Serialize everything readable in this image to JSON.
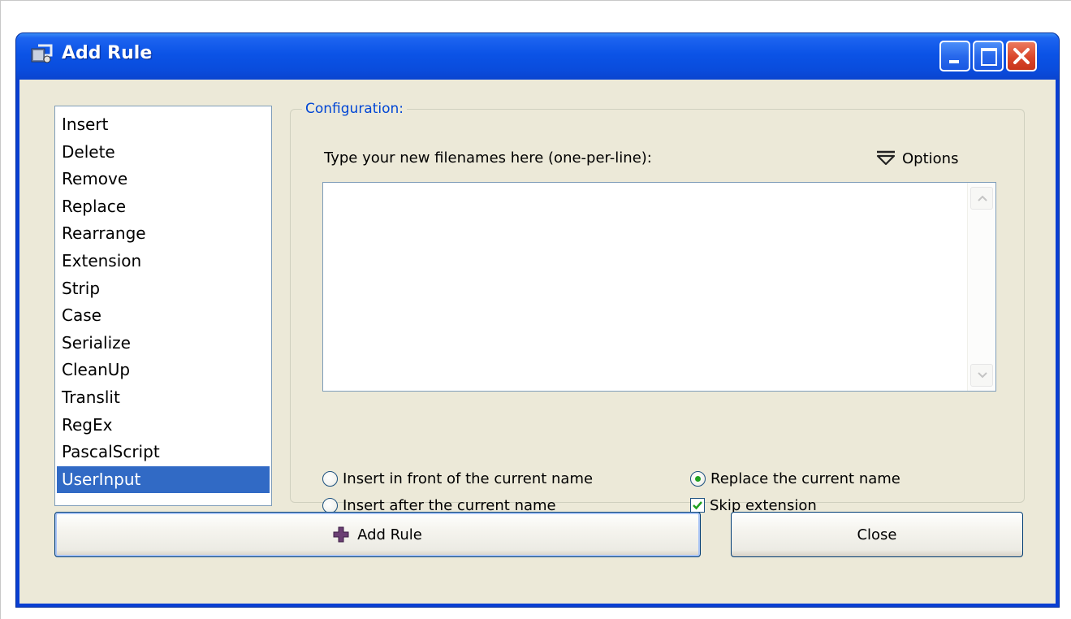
{
  "window": {
    "title": "Add Rule",
    "icon": "app-window-icon",
    "controls": {
      "minimize": "minimize-icon",
      "maximize": "maximize-icon",
      "close": "close-icon"
    }
  },
  "rules": {
    "items": [
      "Insert",
      "Delete",
      "Remove",
      "Replace",
      "Rearrange",
      "Extension",
      "Strip",
      "Case",
      "Serialize",
      "CleanUp",
      "Translit",
      "RegEx",
      "PascalScript",
      "UserInput"
    ],
    "selected": "UserInput"
  },
  "config": {
    "legend": "Configuration:",
    "instructions": "Type your new filenames here (one-per-line):",
    "options_label": "Options",
    "textarea_value": "",
    "radios": {
      "insert_front": "Insert in front of the current name",
      "insert_after": "Insert after the current name",
      "replace": "Replace the current name",
      "selected": "replace"
    },
    "skip_extension": {
      "label": "Skip extension",
      "checked": true
    }
  },
  "buttons": {
    "add_rule": "Add Rule",
    "close": "Close"
  },
  "colors": {
    "title_bar": "#0b53e6",
    "client_bg": "#ece9d8",
    "selection": "#316ac5",
    "legend_text": "#0046d5",
    "radio_dot": "#21a121"
  }
}
